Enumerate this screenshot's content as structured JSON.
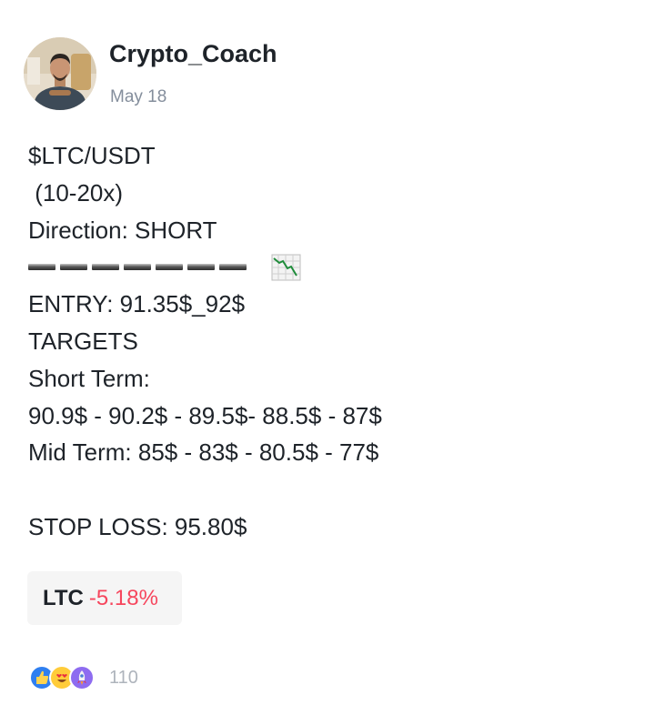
{
  "author": {
    "name": "Crypto_Coach",
    "date": "May 18",
    "avatar_icon": "avatar-photo"
  },
  "post": {
    "lines": {
      "pair": "$LTC/USDT",
      "leverage": " (10-20x)",
      "direction": "Direction: SHORT",
      "entry": "ENTRY: 91.35$_92$",
      "targets": "TARGETS",
      "short_term": "Short Term:",
      "short_term_values": "90.9$ - 90.2$ - 89.5$- 88.5$ - 87$",
      "mid_term": "Mid Term: 85$ - 83$ - 80.5$ - 77$",
      "stop_loss": "STOP LOSS: 95.80$"
    },
    "direction_icon": "chart-decreasing-icon",
    "divider_count": 7
  },
  "coin_card": {
    "symbol": "LTC",
    "change": "-5.18%"
  },
  "reactions": {
    "icons": [
      "thumbs-up-icon",
      "heart-eyes-icon",
      "rocket-icon"
    ],
    "count": "110"
  },
  "colors": {
    "text": "#1e2329",
    "muted": "#848e9c",
    "negative": "#f6465d",
    "card_bg": "#f5f5f5"
  }
}
